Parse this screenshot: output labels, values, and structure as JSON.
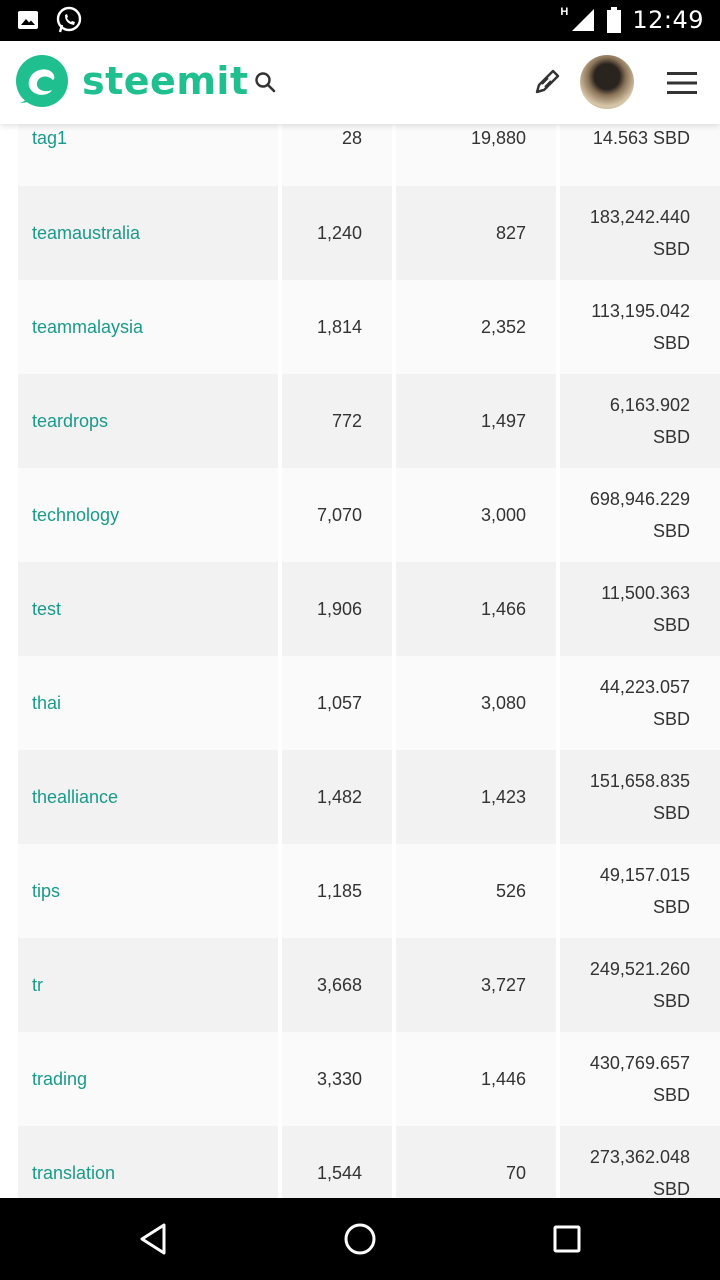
{
  "status_bar": {
    "time": "12:49",
    "network_label": "H",
    "left_icons": [
      "image-icon",
      "whatsapp-icon"
    ],
    "right_icons": [
      "signal-icon",
      "battery-icon"
    ]
  },
  "header": {
    "brand": "steemit",
    "icons": [
      "steemit-logo-icon",
      "search-icon",
      "pencil-icon",
      "avatar",
      "hamburger-menu-icon"
    ]
  },
  "tags_table": {
    "rows": [
      {
        "tag": "tag1",
        "posts": "28",
        "comments": "19,880",
        "payout": "14.563 SBD",
        "payout_value": "",
        "payout_unit": ""
      },
      {
        "tag": "teamaustralia",
        "posts": "1,240",
        "comments": "827",
        "payout": "",
        "payout_value": "183,242.440",
        "payout_unit": "SBD"
      },
      {
        "tag": "teammalaysia",
        "posts": "1,814",
        "comments": "2,352",
        "payout": "",
        "payout_value": "113,195.042",
        "payout_unit": "SBD"
      },
      {
        "tag": "teardrops",
        "posts": "772",
        "comments": "1,497",
        "payout": "",
        "payout_value": "6,163.902",
        "payout_unit": "SBD"
      },
      {
        "tag": "technology",
        "posts": "7,070",
        "comments": "3,000",
        "payout": "",
        "payout_value": "698,946.229",
        "payout_unit": "SBD"
      },
      {
        "tag": "test",
        "posts": "1,906",
        "comments": "1,466",
        "payout": "",
        "payout_value": "11,500.363",
        "payout_unit": "SBD"
      },
      {
        "tag": "thai",
        "posts": "1,057",
        "comments": "3,080",
        "payout": "",
        "payout_value": "44,223.057",
        "payout_unit": "SBD"
      },
      {
        "tag": "thealliance",
        "posts": "1,482",
        "comments": "1,423",
        "payout": "",
        "payout_value": "151,658.835",
        "payout_unit": "SBD"
      },
      {
        "tag": "tips",
        "posts": "1,185",
        "comments": "526",
        "payout": "",
        "payout_value": "49,157.015",
        "payout_unit": "SBD"
      },
      {
        "tag": "tr",
        "posts": "3,668",
        "comments": "3,727",
        "payout": "",
        "payout_value": "249,521.260",
        "payout_unit": "SBD"
      },
      {
        "tag": "trading",
        "posts": "3,330",
        "comments": "1,446",
        "payout": "",
        "payout_value": "430,769.657",
        "payout_unit": "SBD"
      },
      {
        "tag": "translation",
        "posts": "1,544",
        "comments": "70",
        "payout": "",
        "payout_value": "273,362.048",
        "payout_unit": "SBD"
      }
    ]
  },
  "nav_bar": {
    "buttons": [
      "back-icon",
      "home-icon",
      "recents-icon"
    ]
  },
  "colors": {
    "brand": "#1fbf8f",
    "tag_link": "#1a9a8a",
    "row_odd": "#f2f2f2",
    "row_even": "#fafafa"
  }
}
